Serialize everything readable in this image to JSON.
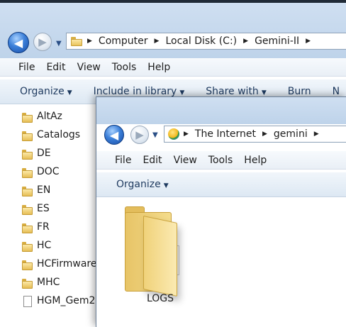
{
  "back_window": {
    "breadcrumbs": [
      "Computer",
      "Local Disk (C:)",
      "Gemini-II"
    ],
    "menu": [
      "File",
      "Edit",
      "View",
      "Tools",
      "Help"
    ],
    "commands": [
      "Organize",
      "Include in library",
      "Share with",
      "Burn",
      "N"
    ],
    "nav_items": [
      {
        "label": "AltAz",
        "icon": "folder-icon"
      },
      {
        "label": "Catalogs",
        "icon": "folder-icon"
      },
      {
        "label": "DE",
        "icon": "folder-icon"
      },
      {
        "label": "DOC",
        "icon": "folder-icon"
      },
      {
        "label": "EN",
        "icon": "folder-icon"
      },
      {
        "label": "ES",
        "icon": "folder-icon"
      },
      {
        "label": "FR",
        "icon": "folder-icon"
      },
      {
        "label": "HC",
        "icon": "folder-icon"
      },
      {
        "label": "HCFirmware",
        "icon": "folder-icon"
      },
      {
        "label": "MHC",
        "icon": "folder-icon"
      },
      {
        "label": "HGM_Gem2.",
        "icon": "file-icon"
      }
    ]
  },
  "front_window": {
    "breadcrumbs": [
      "The Internet",
      "gemini"
    ],
    "menu": [
      "File",
      "Edit",
      "View",
      "Tools",
      "Help"
    ],
    "commands": [
      "Organize"
    ],
    "items": [
      {
        "label": "LOGS",
        "icon": "folder-icon"
      }
    ]
  },
  "icons": {
    "back": "back-arrow-icon",
    "forward": "forward-arrow-icon",
    "recent": "chevron-down-icon",
    "breadcrumb_sep": "chevron-right-icon"
  }
}
